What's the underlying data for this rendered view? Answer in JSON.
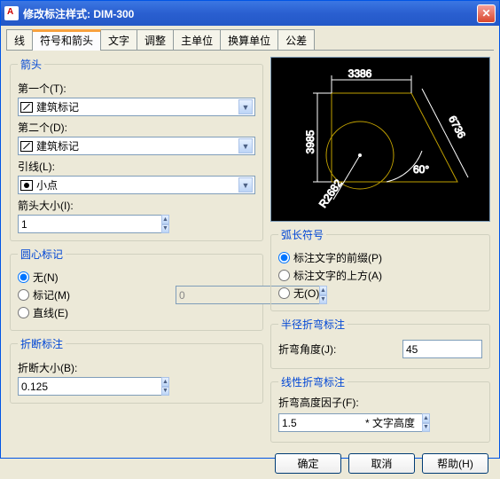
{
  "title": "修改标注样式: DIM-300",
  "tabs": [
    "线",
    "符号和箭头",
    "文字",
    "调整",
    "主单位",
    "换算单位",
    "公差"
  ],
  "active_tab": 1,
  "arrows": {
    "legend": "箭头",
    "first_label": "第一个(T):",
    "first_value": "建筑标记",
    "second_label": "第二个(D):",
    "second_value": "建筑标记",
    "leader_label": "引线(L):",
    "leader_value": "小点",
    "size_label": "箭头大小(I):",
    "size_value": "1"
  },
  "center": {
    "legend": "圆心标记",
    "none": "无(N)",
    "mark": "标记(M)",
    "line": "直线(E)",
    "value": "0",
    "selected": "none"
  },
  "break": {
    "legend": "折断标注",
    "size_label": "折断大小(B):",
    "size_value": "0.125"
  },
  "arc": {
    "legend": "弧长符号",
    "prefix": "标注文字的前缀(P)",
    "above": "标注文字的上方(A)",
    "none": "无(O)",
    "selected": "prefix"
  },
  "radius_jog": {
    "legend": "半径折弯标注",
    "angle_label": "折弯角度(J):",
    "angle_value": "45"
  },
  "linear_jog": {
    "legend": "线性折弯标注",
    "factor_label": "折弯高度因子(F):",
    "factor_value": "1.5",
    "suffix": "* 文字高度"
  },
  "preview": {
    "d1": "3386",
    "d2": "3985",
    "d3": "6736",
    "ang": "60°",
    "r": "R2682"
  },
  "buttons": {
    "ok": "确定",
    "cancel": "取消",
    "help": "帮助(H)"
  }
}
